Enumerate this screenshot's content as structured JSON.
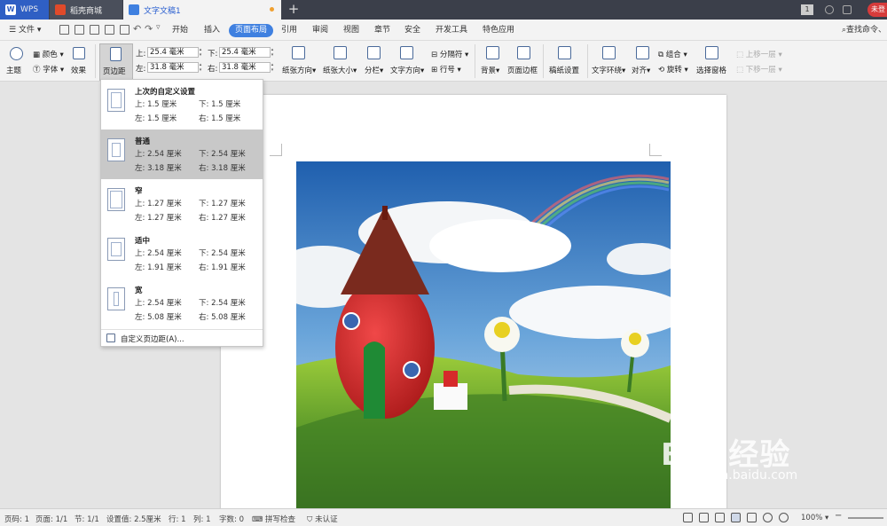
{
  "titlebar": {
    "tabs": [
      {
        "label": "WPS"
      },
      {
        "label": "稻壳商城"
      },
      {
        "label": "文字文稿1"
      }
    ],
    "user_badge": "未登",
    "page_badge": "1"
  },
  "menubar": {
    "file_label": "文件",
    "items": [
      "开始",
      "插入",
      "页面布局",
      "引用",
      "审阅",
      "视图",
      "章节",
      "安全",
      "开发工具",
      "特色应用"
    ],
    "active_item": "页面布局",
    "search_label": "查找命令、"
  },
  "ribbon": {
    "theme": "主题",
    "colors": "颜色",
    "font": "字体",
    "effects": "效果",
    "margins": "页边距",
    "top_label": "上:",
    "top_value": "25.4 毫米",
    "bottom_label": "下:",
    "bottom_value": "25.4 毫米",
    "left_label": "左:",
    "left_value": "31.8 毫米",
    "right_label": "右:",
    "right_value": "31.8 毫米",
    "orientation": "纸张方向",
    "size": "纸张大小",
    "columns": "分栏",
    "text_direction": "文字方向",
    "separator": "分隔符",
    "line_numbers": "行号",
    "background": "背景",
    "page_border": "页面边框",
    "draft_paper": "稿纸设置",
    "wrap_text": "文字环绕",
    "align": "对齐",
    "group": "组合",
    "rotate": "旋转",
    "selection_pane": "选择窗格",
    "bring_forward": "上移一层",
    "send_backward": "下移一层"
  },
  "dropdown": {
    "options": [
      {
        "title": "上次的自定义设置",
        "top": "上: 1.5 厘米",
        "bottom": "下: 1.5 厘米",
        "left": "左: 1.5 厘米",
        "right": "右: 1.5 厘米"
      },
      {
        "title": "普通",
        "top": "上: 2.54 厘米",
        "bottom": "下: 2.54 厘米",
        "left": "左: 3.18 厘米",
        "right": "右: 3.18 厘米"
      },
      {
        "title": "窄",
        "top": "上: 1.27 厘米",
        "bottom": "下: 1.27 厘米",
        "left": "左: 1.27 厘米",
        "right": "右: 1.27 厘米"
      },
      {
        "title": "适中",
        "top": "上: 2.54 厘米",
        "bottom": "下: 2.54 厘米",
        "left": "左: 1.91 厘米",
        "right": "右: 1.91 厘米"
      },
      {
        "title": "宽",
        "top": "上: 2.54 厘米",
        "bottom": "下: 2.54 厘米",
        "left": "左: 5.08 厘米",
        "right": "右: 5.08 厘米"
      }
    ],
    "selected": "普通",
    "custom": "自定义页边距(A)..."
  },
  "statusbar": {
    "page_num": "页码: 1",
    "pages": "页面: 1/1",
    "section": "节: 1/1",
    "setting": "设置值: 2.5厘米",
    "row": "行: 1",
    "col": "列: 1",
    "word_count": "字数: 0",
    "spell_check": "拼写检查",
    "auth": "未认证",
    "zoom": "100%"
  },
  "watermark": {
    "main": "Bai 经验",
    "sub": "jingyan.baidu.com"
  },
  "colors": {
    "accent": "#3f80e0",
    "titlebar": "#3b3f4a",
    "selected_row": "#c8c8c8",
    "badge": "#d63b3b"
  }
}
